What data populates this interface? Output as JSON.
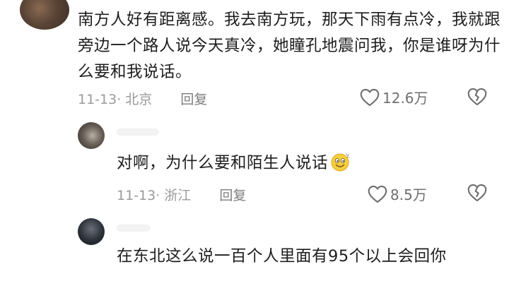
{
  "main_comment": {
    "text": "南方人好有距离感。我去南方玩，那天下雨有点冷，我就跟旁边一个路人说今天真冷，她瞳孔地震问我，你是谁呀为什么要和我说话。",
    "meta": "11-13· 北京",
    "reply_label": "回复",
    "likes": "12.6万"
  },
  "reply1": {
    "text": "对啊，为什么要和陌生人说话",
    "emoji": "smiling-face-emoji",
    "meta": "11-13· 浙江",
    "reply_label": "回复",
    "likes": "8.5万"
  },
  "reply2": {
    "text": "在东北这么说一百个人里面有95个以上会回你"
  },
  "icons": {
    "heart": "heart-outline-icon",
    "dislike": "broken-heart-icon"
  },
  "colors": {
    "text": "#1d1d1d",
    "meta": "#9a9a9a",
    "icon": "#6f6f6f"
  }
}
